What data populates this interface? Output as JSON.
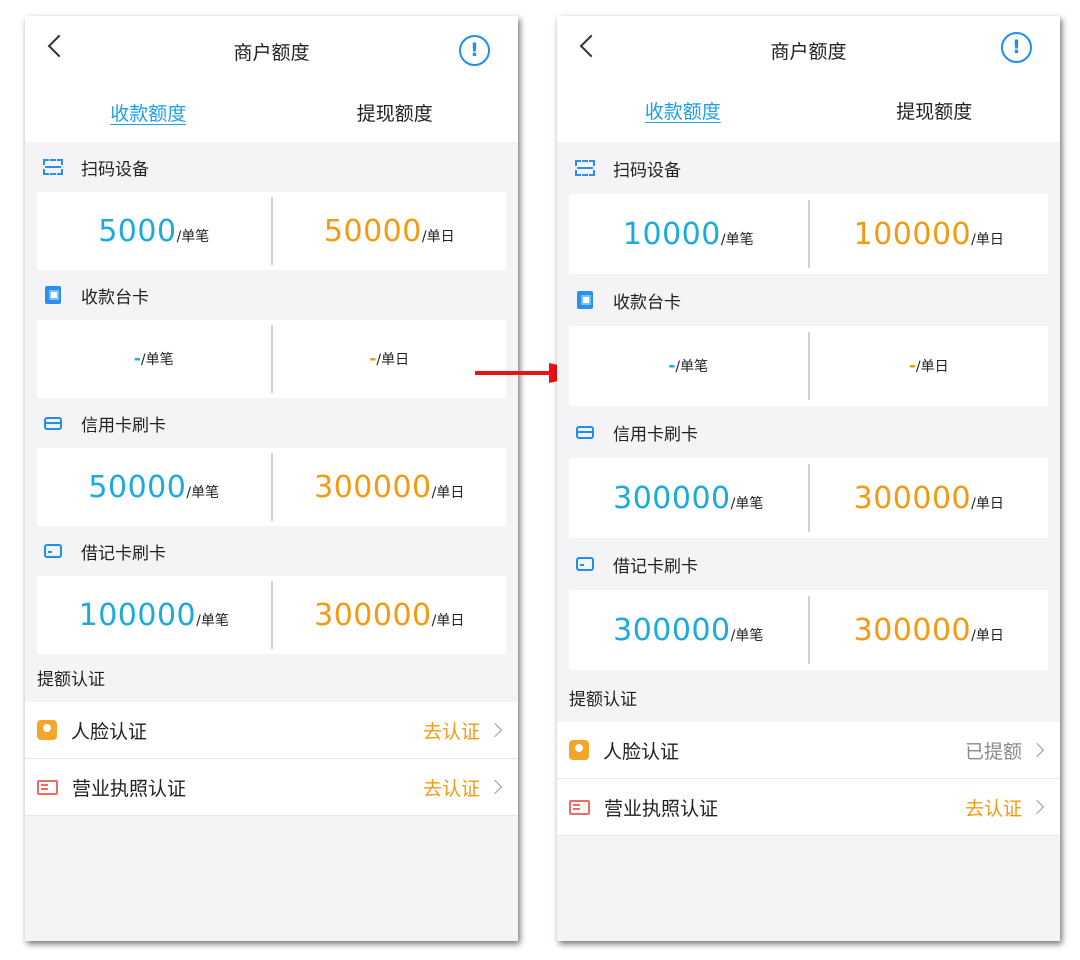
{
  "screens": [
    {
      "header": {
        "title": "商户额度"
      },
      "tabs": [
        "收款额度",
        "提现额度"
      ],
      "sections": [
        {
          "icon": "scan-icon",
          "title": "扫码设备",
          "single": "5000",
          "daily": "50000"
        },
        {
          "icon": "qr-card-icon",
          "title": "收款台卡",
          "single": "-",
          "daily": "-"
        },
        {
          "icon": "credit-card-icon",
          "title": "信用卡刷卡",
          "single": "50000",
          "daily": "300000"
        },
        {
          "icon": "debit-card-icon",
          "title": "借记卡刷卡",
          "single": "100000",
          "daily": "300000"
        }
      ],
      "units": {
        "single": "/单笔",
        "daily": "/单日"
      },
      "cert": {
        "title": "提额认证",
        "items": [
          {
            "icon": "face-icon",
            "label": "人脸认证",
            "status": "去认证"
          },
          {
            "icon": "license-icon",
            "label": "营业执照认证",
            "status": "去认证"
          }
        ]
      }
    },
    {
      "header": {
        "title": "商户额度"
      },
      "tabs": [
        "收款额度",
        "提现额度"
      ],
      "sections": [
        {
          "icon": "scan-icon",
          "title": "扫码设备",
          "single": "10000",
          "daily": "100000"
        },
        {
          "icon": "qr-card-icon",
          "title": "收款台卡",
          "single": "-",
          "daily": "-"
        },
        {
          "icon": "credit-card-icon",
          "title": "信用卡刷卡",
          "single": "300000",
          "daily": "300000"
        },
        {
          "icon": "debit-card-icon",
          "title": "借记卡刷卡",
          "single": "300000",
          "daily": "300000"
        }
      ],
      "units": {
        "single": "/单笔",
        "daily": "/单日"
      },
      "cert": {
        "title": "提额认证",
        "items": [
          {
            "icon": "face-icon",
            "label": "人脸认证",
            "status": "已提额"
          },
          {
            "icon": "license-icon",
            "label": "营业执照认证",
            "status": "去认证"
          }
        ]
      }
    }
  ],
  "colors": {
    "blue": "#1aa9e0",
    "orange": "#f39a12",
    "arrow": "#ee1111",
    "tab_active": "#1ea0e8"
  }
}
